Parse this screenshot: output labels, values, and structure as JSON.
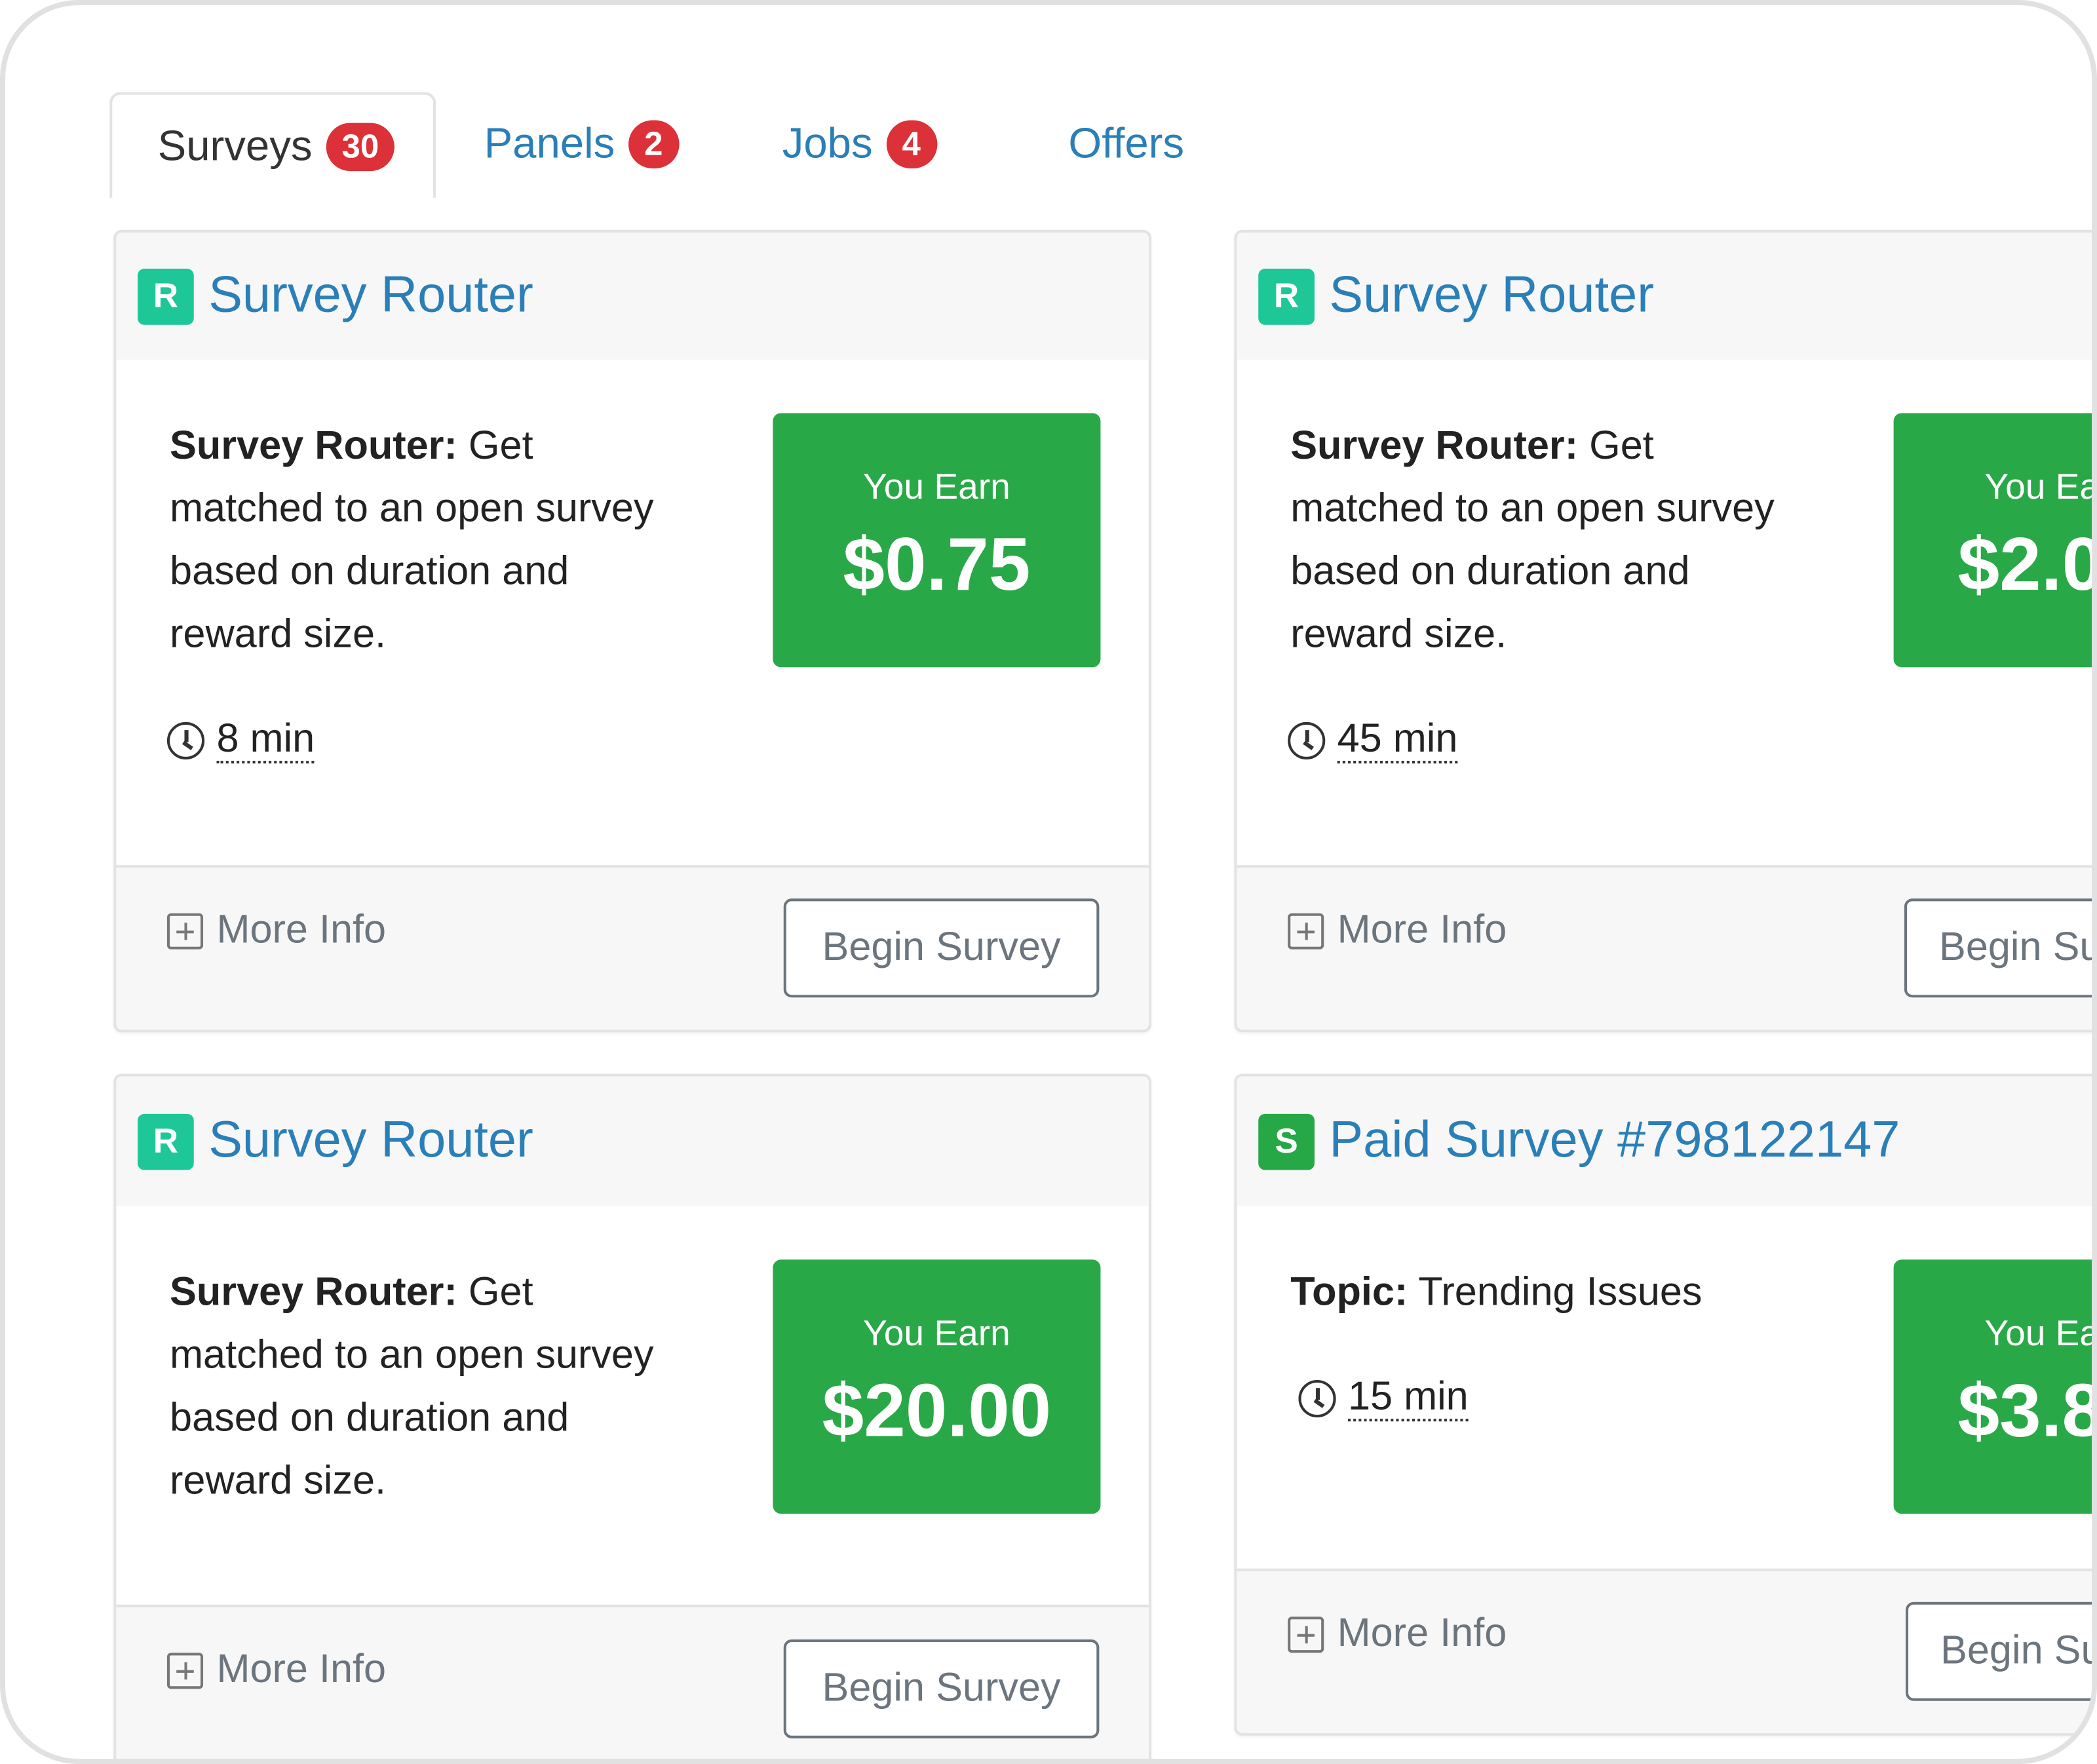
{
  "tabs": [
    {
      "label": "Surveys",
      "badge": "30",
      "active": true
    },
    {
      "label": "Panels",
      "badge": "2"
    },
    {
      "label": "Jobs",
      "badge": "4"
    },
    {
      "label": "Offers"
    }
  ],
  "cards": [
    {
      "logo": "R",
      "title": "Survey Router",
      "desc_bold": "Survey Router:",
      "desc": " Get matched to an open survey based on duration and reward size.",
      "earn_label": "You Earn",
      "amount": "$0.75",
      "duration": "8 min",
      "more_info": "More Info",
      "button": "Begin Survey"
    },
    {
      "logo": "R",
      "title": "Survey Router",
      "desc_bold": "Survey Router:",
      "desc": " Get matched to an open survey based on duration and reward size.",
      "earn_label": "You Ea",
      "amount": "$2.0",
      "duration": "45 min",
      "more_info": "More Info",
      "button": "Begin Su"
    },
    {
      "logo": "R",
      "title": "Survey Router",
      "desc_bold": "Survey Router:",
      "desc": " Get matched to an open survey based on duration and reward size.",
      "earn_label": "You Earn",
      "amount": "$20.00",
      "more_info": "More Info",
      "button": "Begin Survey"
    },
    {
      "logo": "S",
      "title": "Paid Survey #798122147",
      "desc_bold": "Topic:",
      "desc": " Trending Issues",
      "earn_label": "You Ea",
      "amount": "$3.8",
      "duration": "15 min",
      "more_info": "More Info",
      "button": "Begin Su"
    }
  ],
  "icons": {
    "clock": "clock-icon",
    "expand": "plus-square-icon"
  },
  "colors": {
    "accent": "#2a7fb8",
    "badge": "#dc3138",
    "earn": "#29a847",
    "logo_router": "#1ec797",
    "logo_survey": "#27a847"
  }
}
